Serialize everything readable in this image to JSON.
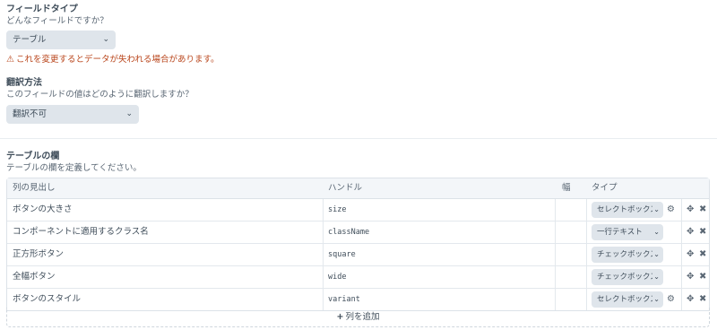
{
  "field_type": {
    "heading": "フィールドタイプ",
    "instructions": "どんなフィールドですか？",
    "selected": "テーブル",
    "warning": "これを変更するとデータが失われる場合があります。"
  },
  "translation": {
    "heading": "翻訳方法",
    "instructions": "このフィールドの値はどのように翻訳しますか？",
    "selected": "翻訳不可"
  },
  "columns": {
    "heading": "テーブルの欄",
    "instructions": "テーブルの欄を定義してください。",
    "headers": {
      "col_heading": "列の見出し",
      "handle": "ハンドル",
      "width": "幅",
      "type": "タイプ"
    },
    "rows": [
      {
        "heading": "ボタンの大きさ",
        "handle": "size",
        "type": "セレクトボックス",
        "has_settings": true
      },
      {
        "heading": "コンポーネントに適用するクラス名",
        "handle": "className",
        "type": "一行テキスト",
        "has_settings": false
      },
      {
        "heading": "正方形ボタン",
        "handle": "square",
        "type": "チェックボックス",
        "has_settings": false
      },
      {
        "heading": "全幅ボタン",
        "handle": "wide",
        "type": "チェックボックス",
        "has_settings": false
      },
      {
        "heading": "ボタンのスタイル",
        "handle": "variant",
        "type": "セレクトボックス",
        "has_settings": true
      }
    ],
    "add_label": "列を追加"
  },
  "icons": {
    "chevron": "chevron-down-icon",
    "warning": "warning-triangle-icon",
    "settings": "gear-icon",
    "move": "move-icon",
    "delete": "delete-x-icon",
    "add": "plus-icon"
  },
  "colors": {
    "warning": "#b9451b",
    "select_bg": "#dfe5eb",
    "header_bg": "#f3f6f9"
  }
}
